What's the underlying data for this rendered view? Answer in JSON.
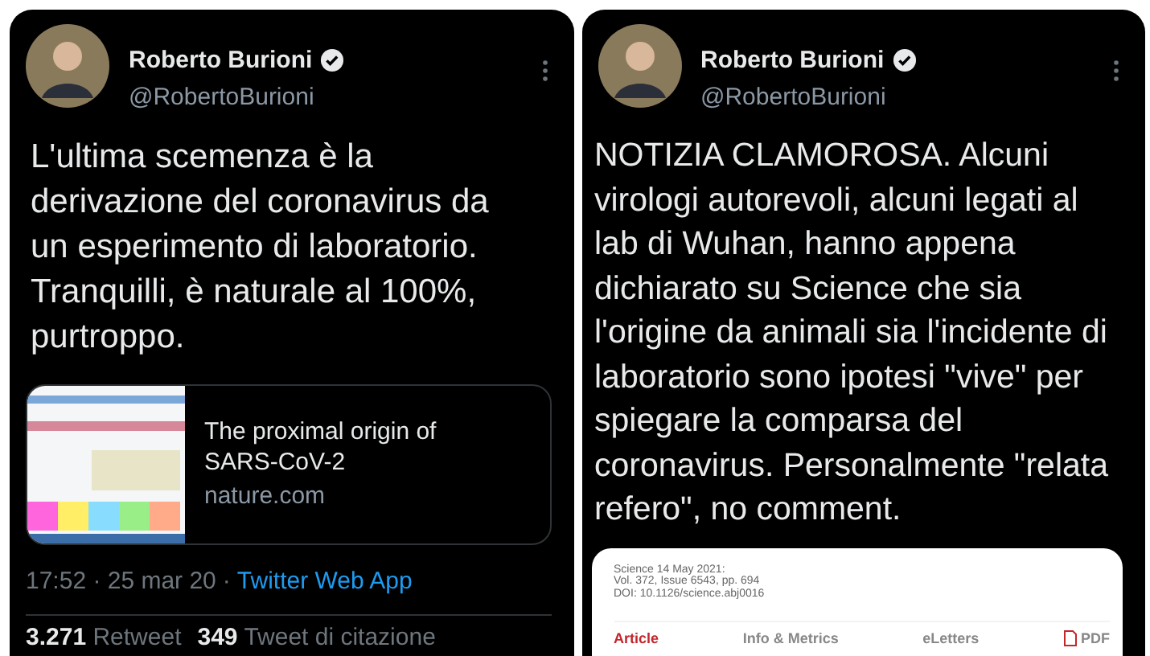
{
  "tweets": [
    {
      "author": {
        "name": "Roberto Burioni",
        "handle": "@RobertoBurioni",
        "verified": true
      },
      "text": "L'ultima scemenza è la derivazione del coronavirus da un esperimento di laboratorio. Tranquilli, è naturale al 100%, purtroppo.",
      "attachment": {
        "kind": "link_card",
        "title": "The proximal origin of SARS-CoV-2",
        "domain": "nature.com"
      },
      "meta": {
        "timestamp": "17:52 · 25 mar 20",
        "separator": "·",
        "source": "Twitter Web App"
      },
      "stats": [
        {
          "count": "3.271",
          "label": "Retweet"
        },
        {
          "count": "349",
          "label": "Tweet di citazione"
        }
      ]
    },
    {
      "author": {
        "name": "Roberto Burioni",
        "handle": "@RobertoBurioni",
        "verified": true
      },
      "text": "NOTIZIA CLAMOROSA. Alcuni virologi autorevoli, alcuni legati al lab di Wuhan, hanno appena dichiarato su Science che sia l'origine da animali sia l'incidente di laboratorio sono ipotesi \"vive\" per spiegare la comparsa del coronavirus. Personalmente \"relata refero\", no comment.",
      "attachment": {
        "kind": "page_screenshot",
        "citation_lines": [
          "Science 14 May 2021:",
          "Vol. 372, Issue 6543, pp. 694",
          "DOI: 10.1126/science.abj0016"
        ],
        "tabs": [
          {
            "label": "Article",
            "selected": true,
            "kind": "text"
          },
          {
            "label": "Info & Metrics",
            "selected": false,
            "kind": "text"
          },
          {
            "label": "eLetters",
            "selected": false,
            "kind": "text"
          },
          {
            "label": "PDF",
            "selected": false,
            "kind": "pdf"
          }
        ]
      }
    }
  ]
}
